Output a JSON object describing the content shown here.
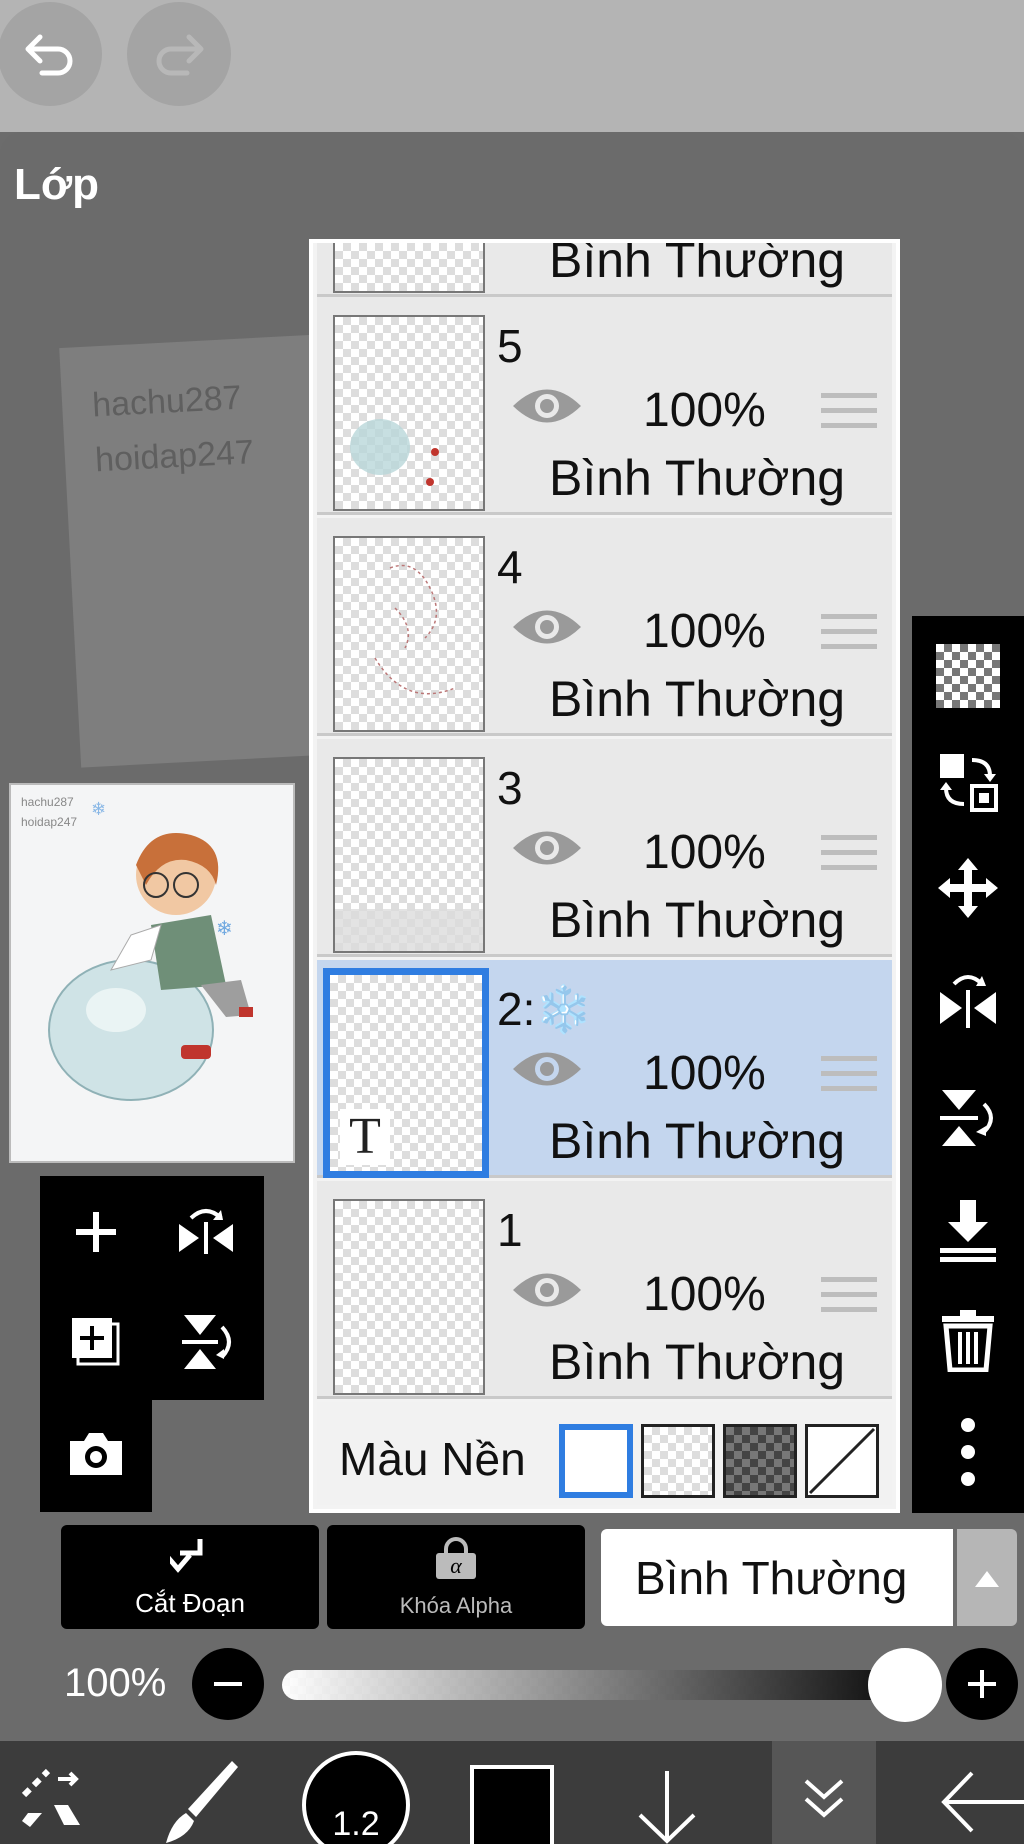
{
  "panel": {
    "title": "Lớp"
  },
  "canvas_watermark": {
    "line1": "hachu287",
    "line2": "hoidap247"
  },
  "preview_watermark": {
    "line1": "hachu287",
    "line2": "hoidap247"
  },
  "partial_layer": {
    "blend": "Bình Thường"
  },
  "layers": [
    {
      "name": "5",
      "opacity": "100%",
      "blend": "Bình Thường",
      "visible_icon": "eye-icon",
      "selected": false
    },
    {
      "name": "4",
      "opacity": "100%",
      "blend": "Bình Thường",
      "visible_icon": "eye-icon",
      "selected": false
    },
    {
      "name": "3",
      "opacity": "100%",
      "blend": "Bình Thường",
      "visible_icon": "eye-icon",
      "selected": false
    },
    {
      "name": "2:",
      "name_emoji": "❄️",
      "opacity": "100%",
      "blend": "Bình Thường",
      "visible_icon": "eye-icon",
      "selected": true,
      "thumb_badge": "T"
    },
    {
      "name": "1",
      "opacity": "100%",
      "blend": "Bình Thường",
      "visible_icon": "eye-icon",
      "selected": false
    }
  ],
  "background_color": {
    "label": "Màu Nền",
    "options": [
      "white",
      "transparent",
      "dark-checker",
      "none"
    ],
    "selected": "white"
  },
  "buttons": {
    "clip": "Cắt Đoạn",
    "alpha_lock": "Khóa Alpha",
    "alpha_symbol": "α"
  },
  "blend_mode": {
    "value": "Bình Thường"
  },
  "opacity": {
    "label": "100%",
    "value": 1.0
  },
  "brush": {
    "size": "1.2"
  },
  "colors": {
    "accent": "#2f7de1",
    "selected_layer_bg": "#c4d6ee",
    "toolbar": "#000000"
  }
}
